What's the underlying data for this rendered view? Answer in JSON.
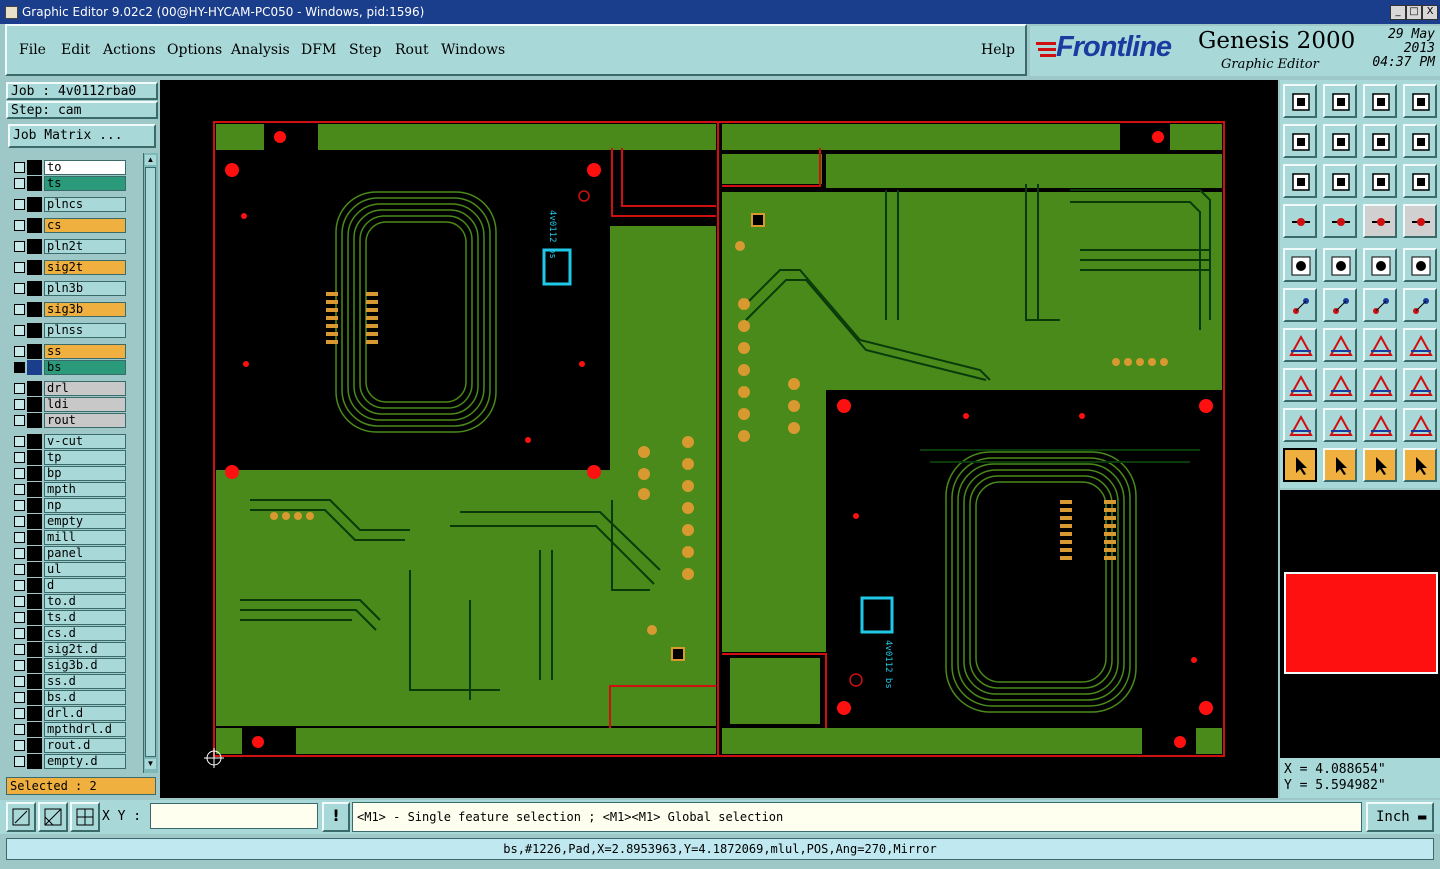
{
  "window": {
    "title": "Graphic Editor 9.02c2 (00@HY-HYCAM-PC050 - Windows, pid:1596)",
    "min": "_",
    "max": "□",
    "close": "X"
  },
  "menu": {
    "items": [
      "File",
      "Edit",
      "Actions",
      "Options",
      "Analysis",
      "DFM",
      "Step",
      "Rout",
      "Windows"
    ],
    "help": "Help"
  },
  "brand": {
    "logo": "Frontline",
    "product": "Genesis 2000",
    "subtitle": "Graphic Editor",
    "date": "29 May 2013",
    "time": "04:37 PM"
  },
  "job": {
    "job_label": "Job : 4v0112rba0",
    "step_label": "Step: cam",
    "matrix_button": "Job Matrix ..."
  },
  "layers": [
    {
      "name": "to",
      "color": "#ffffff"
    },
    {
      "name": "ts",
      "color": "#2a9a7a"
    },
    {
      "name": "plncs",
      "color": "#a8d8d8"
    },
    {
      "name": "cs",
      "color": "#f0b040"
    },
    {
      "name": "pln2t",
      "color": "#a8d8d8"
    },
    {
      "name": "sig2t",
      "color": "#f0b040"
    },
    {
      "name": "pln3b",
      "color": "#a8d8d8"
    },
    {
      "name": "sig3b",
      "color": "#f0b040"
    },
    {
      "name": "plnss",
      "color": "#a8d8d8"
    },
    {
      "name": "ss",
      "color": "#f0b040"
    },
    {
      "name": "bs",
      "color": "#2a9a7a"
    },
    {
      "name": "drl",
      "color": "#c8c8c8"
    },
    {
      "name": "ldi",
      "color": "#c8c8c8"
    },
    {
      "name": "rout",
      "color": "#c8c8c8"
    },
    {
      "name": "v-cut",
      "color": "#a8d8d8"
    },
    {
      "name": "tp",
      "color": "#a8d8d8"
    },
    {
      "name": "bp",
      "color": "#a8d8d8"
    },
    {
      "name": "mpth",
      "color": "#a8d8d8"
    },
    {
      "name": "np",
      "color": "#a8d8d8"
    },
    {
      "name": "empty",
      "color": "#a8d8d8"
    },
    {
      "name": "mill",
      "color": "#a8d8d8"
    },
    {
      "name": "panel",
      "color": "#a8d8d8"
    },
    {
      "name": "ul",
      "color": "#a8d8d8"
    },
    {
      "name": "d",
      "color": "#a8d8d8"
    },
    {
      "name": "to.d",
      "color": "#a8d8d8"
    },
    {
      "name": "ts.d",
      "color": "#a8d8d8"
    },
    {
      "name": "cs.d",
      "color": "#a8d8d8"
    },
    {
      "name": "sig2t.d",
      "color": "#a8d8d8"
    },
    {
      "name": "sig3b.d",
      "color": "#a8d8d8"
    },
    {
      "name": "ss.d",
      "color": "#a8d8d8"
    },
    {
      "name": "bs.d",
      "color": "#a8d8d8"
    },
    {
      "name": "drl.d",
      "color": "#a8d8d8"
    },
    {
      "name": "mpthdrl.d",
      "color": "#a8d8d8"
    },
    {
      "name": "rout.d",
      "color": "#a8d8d8"
    },
    {
      "name": "empty.d",
      "color": "#a8d8d8"
    }
  ],
  "selected": "Selected : 2",
  "coords": {
    "x": "X = 4.088654\"",
    "y": "Y = 5.594982\""
  },
  "input": {
    "xy_label": "X Y :",
    "xy_value": ""
  },
  "hint": "<M1> - Single feature selection ; <M1><M1> Global selection",
  "units": "Inch",
  "status": "bs,#1226,Pad,X=2.8953963,Y=4.1872069,mlul,POS,Ang=270,Mirror",
  "board_text": {
    "left_label": "4v0112 bs",
    "right_label": "4v0112 bs"
  },
  "colors": {
    "board": "#4a8a1a",
    "trace": "#0a3a0a",
    "pad": "#d89a30",
    "outline": "#d01010",
    "active": "#ff1010"
  }
}
